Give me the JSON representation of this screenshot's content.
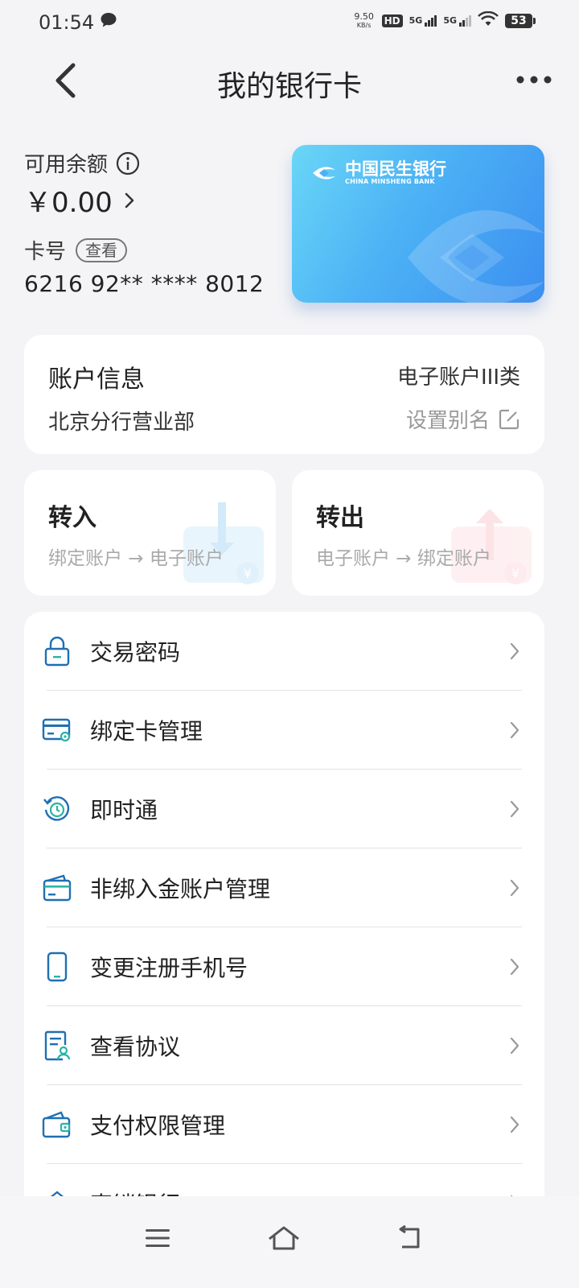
{
  "status_bar": {
    "time": "01:54",
    "net_speed_value": "9.50",
    "net_speed_unit": "KB/s",
    "hd_label": "HD",
    "sim1_label": "5G",
    "sim2_label": "5G",
    "battery": "53"
  },
  "header": {
    "title": "我的银行卡"
  },
  "balance": {
    "label": "可用余额",
    "value": "￥0.00"
  },
  "card": {
    "number_label": "卡号",
    "view_label": "查看",
    "number": "6216 92** **** 8012",
    "bank_name": "中国民生银行",
    "bank_name_en": "CHINA MINSHENG BANK"
  },
  "account_info": {
    "title": "账户信息",
    "type": "电子账户III类",
    "branch": "北京分行营业部",
    "alias_label": "设置别名"
  },
  "transfer": {
    "in_title": "转入",
    "in_desc": "绑定账户 → 电子账户",
    "out_title": "转出",
    "out_desc": "电子账户 → 绑定账户"
  },
  "menu": {
    "items": [
      {
        "label": "交易密码",
        "icon": "lock-icon"
      },
      {
        "label": "绑定卡管理",
        "icon": "card-settings-icon"
      },
      {
        "label": "即时通",
        "icon": "clock-refresh-icon"
      },
      {
        "label": "非绑入金账户管理",
        "icon": "card-icon"
      },
      {
        "label": "变更注册手机号",
        "icon": "phone-icon"
      },
      {
        "label": "查看协议",
        "icon": "document-user-icon"
      },
      {
        "label": "支付权限管理",
        "icon": "wallet-icon"
      },
      {
        "label": "直销银行",
        "icon": "home-icon"
      }
    ]
  },
  "colors": {
    "accent_blue": "#1f6fb5",
    "teal": "#2bb3a6",
    "card_gradient_start": "#6ad6f6",
    "card_gradient_end": "#3c8ff0"
  }
}
